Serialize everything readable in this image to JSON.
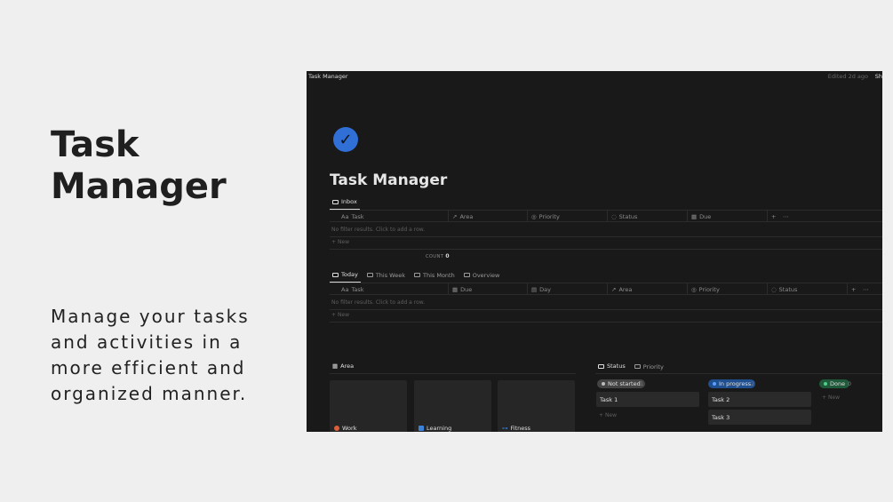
{
  "hero": {
    "title_line1": "Task",
    "title_line2": "Manager",
    "subtitle": "Manage your tasks and activities in a more efficient and organized manner."
  },
  "app": {
    "window_title": "Task Manager",
    "edited": "Edited 2d ago",
    "share": "Sh",
    "page_title": "Task Manager",
    "accent": "#2f6fd6"
  },
  "inbox": {
    "tab": "Inbox",
    "columns": [
      "Task",
      "Area",
      "Priority",
      "Status",
      "Due"
    ],
    "col_prefix": "Aa",
    "empty": "No filter results. Click to add a row.",
    "new_label": "New",
    "count_label": "COUNT",
    "count_value": "0"
  },
  "today": {
    "tabs": [
      "Today",
      "This Week",
      "This Month",
      "Overview"
    ],
    "columns": [
      "Task",
      "Due",
      "Day",
      "Area",
      "Priority",
      "Status"
    ],
    "col_prefix": "Aa",
    "empty": "No filter results. Click to add a row.",
    "new_label": "New"
  },
  "gallery": {
    "tab": "Area",
    "cards": [
      {
        "label": "Work",
        "color": "#d9603b"
      },
      {
        "label": "Learning",
        "color": "#3b82d9"
      },
      {
        "label": "Fitness",
        "color": "#3b82d9"
      }
    ]
  },
  "board": {
    "tabs": [
      "Status",
      "Priority"
    ],
    "groups": [
      {
        "label": "Not started",
        "count": "1",
        "color": "#555555",
        "dot": "#bbbbbb",
        "cards": [
          "Task 1"
        ],
        "new_label": "New"
      },
      {
        "label": "In progress",
        "count": "2",
        "color": "#1f4f8f",
        "dot": "#5aa0ff",
        "cards": [
          "Task 2",
          "Task 3"
        ],
        "new_label": ""
      },
      {
        "label": "Done",
        "count": "0",
        "color": "#1f5a3a",
        "dot": "#4fcf8a",
        "cards": [],
        "new_label": "New"
      }
    ]
  }
}
